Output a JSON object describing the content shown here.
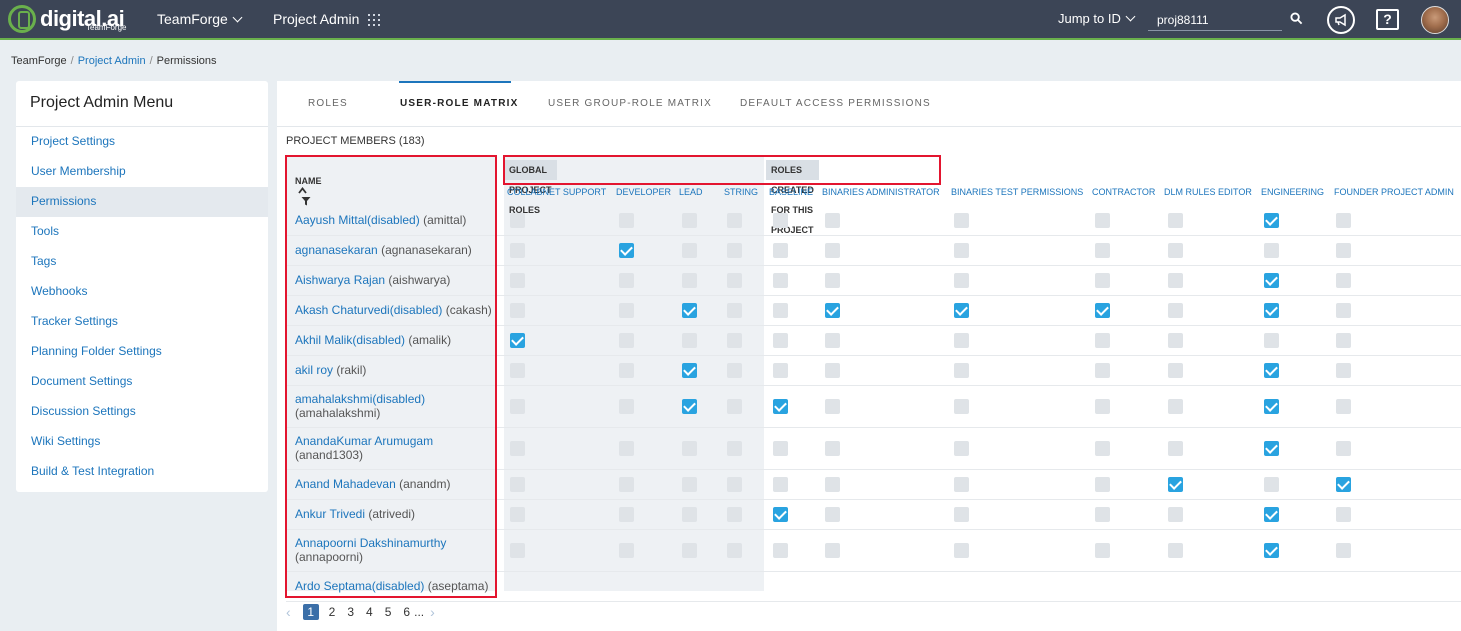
{
  "topbar": {
    "logo": "digital.ai",
    "logo_sub": "TeamForge",
    "product": "TeamForge",
    "project_admin": "Project Admin",
    "jump_to": "Jump to ID",
    "search_value": "proj88111"
  },
  "breadcrumb": {
    "root": "TeamForge",
    "middle": "Project Admin",
    "current": "Permissions"
  },
  "sidebar": {
    "title": "Project Admin Menu",
    "items": [
      "Project Settings",
      "User Membership",
      "Permissions",
      "Tools",
      "Tags",
      "Webhooks",
      "Tracker Settings",
      "Planning Folder Settings",
      "Document Settings",
      "Discussion Settings",
      "Wiki Settings",
      "Build & Test Integration"
    ],
    "active_index": 2
  },
  "tabs": [
    "ROLES",
    "USER-ROLE MATRIX",
    "USER GROUP-ROLE MATRIX",
    "DEFAULT ACCESS PERMISSIONS"
  ],
  "active_tab": 1,
  "members_title": "PROJECT MEMBERS (183)",
  "matrix": {
    "name_header": "NAME",
    "global_label": "GLOBAL PROJECT ROLES",
    "project_label": "ROLES CREATED FOR THIS PROJECT",
    "roles": [
      "COLLABNET SUPPORT",
      "DEVELOPER",
      "LEAD",
      "STRING",
      "BASELINE",
      "BINARIES ADMINISTRATOR",
      "BINARIES TEST PERMISSIONS",
      "CONTRACTOR",
      "DLM RULES EDITOR",
      "ENGINEERING",
      "FOUNDER PROJECT ADMIN"
    ],
    "members": [
      {
        "name": "Aayush Mittal(disabled)",
        "user": "(amittal)",
        "wrap": false,
        "checks": [
          0,
          0,
          0,
          0,
          0,
          0,
          0,
          0,
          0,
          1,
          0
        ]
      },
      {
        "name": "agnanasekaran",
        "user": "(agnanasekaran)",
        "wrap": false,
        "checks": [
          0,
          1,
          0,
          0,
          0,
          0,
          0,
          0,
          0,
          0,
          0
        ]
      },
      {
        "name": "Aishwarya Rajan",
        "user": "(aishwarya)",
        "wrap": false,
        "checks": [
          0,
          0,
          0,
          0,
          0,
          0,
          0,
          0,
          0,
          1,
          0
        ]
      },
      {
        "name": "Akash Chaturvedi(disabled)",
        "user": "(cakash)",
        "wrap": false,
        "checks": [
          0,
          0,
          1,
          0,
          0,
          1,
          1,
          1,
          0,
          1,
          0
        ]
      },
      {
        "name": "Akhil Malik(disabled)",
        "user": "(amalik)",
        "wrap": false,
        "checks": [
          1,
          0,
          0,
          0,
          0,
          0,
          0,
          0,
          0,
          0,
          0
        ]
      },
      {
        "name": "akil roy",
        "user": "(rakil)",
        "wrap": false,
        "checks": [
          0,
          0,
          1,
          0,
          0,
          0,
          0,
          0,
          0,
          1,
          0
        ]
      },
      {
        "name": "amahalakshmi(disabled)",
        "user": "(amahalakshmi)",
        "wrap": true,
        "checks": [
          0,
          0,
          1,
          0,
          1,
          0,
          0,
          0,
          0,
          1,
          0
        ]
      },
      {
        "name": "AnandaKumar Arumugam",
        "user": "(anand1303)",
        "wrap": true,
        "checks": [
          0,
          0,
          0,
          0,
          0,
          0,
          0,
          0,
          0,
          1,
          0
        ]
      },
      {
        "name": "Anand Mahadevan",
        "user": "(anandm)",
        "wrap": false,
        "checks": [
          0,
          0,
          0,
          0,
          0,
          0,
          0,
          0,
          1,
          0,
          1
        ]
      },
      {
        "name": "Ankur Trivedi",
        "user": "(atrivedi)",
        "wrap": false,
        "checks": [
          0,
          0,
          0,
          0,
          1,
          0,
          0,
          0,
          0,
          1,
          0
        ]
      },
      {
        "name": "Annapoorni Dakshinamurthy",
        "user": "(annapoorni)",
        "wrap": true,
        "checks": [
          0,
          0,
          0,
          0,
          0,
          0,
          0,
          0,
          0,
          1,
          0
        ]
      },
      {
        "name": "Ardo Septama(disabled)",
        "user": "(aseptama)",
        "wrap": false,
        "checks": [
          0,
          0,
          0,
          0,
          0,
          0,
          0,
          0,
          0,
          0,
          0
        ]
      }
    ]
  },
  "pager": {
    "pages": [
      "1",
      "2",
      "3",
      "4",
      "5",
      "6"
    ],
    "current": "1",
    "ellipsis": "..."
  }
}
